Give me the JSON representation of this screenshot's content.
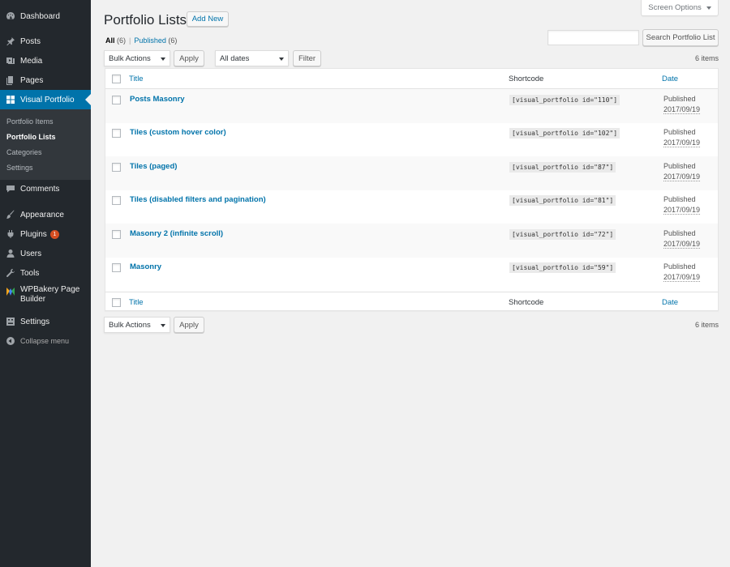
{
  "sidebar": {
    "menu": [
      {
        "label": "Dashboard",
        "icon": "dashboard-icon"
      },
      {
        "label": "Posts",
        "icon": "pin-icon"
      },
      {
        "label": "Media",
        "icon": "media-icon"
      },
      {
        "label": "Pages",
        "icon": "pages-icon"
      },
      {
        "label": "Visual Portfolio",
        "icon": "grid-icon"
      },
      {
        "label": "Comments",
        "icon": "comment-icon"
      },
      {
        "label": "Appearance",
        "icon": "brush-icon"
      },
      {
        "label": "Plugins",
        "icon": "plug-icon",
        "badge": "1"
      },
      {
        "label": "Users",
        "icon": "user-icon"
      },
      {
        "label": "Tools",
        "icon": "wrench-icon"
      },
      {
        "label_line1": "WPBakery Page",
        "label_line2": "Builder",
        "icon": "wpbakery-icon"
      },
      {
        "label": "Settings",
        "icon": "settings-icon"
      },
      {
        "label": "Collapse menu",
        "icon": "collapse-icon"
      }
    ],
    "submenu": [
      {
        "label": "Portfolio Items"
      },
      {
        "label": "Portfolio Lists"
      },
      {
        "label": "Categories"
      },
      {
        "label": "Settings"
      }
    ]
  },
  "header": {
    "title": "Portfolio Lists",
    "add_new": "Add New",
    "screen_options": "Screen Options"
  },
  "filters": {
    "all": "All",
    "all_count": "(6)",
    "sep": "|",
    "published": "Published",
    "published_count": "(6)"
  },
  "search": {
    "value": "",
    "button": "Search Portfolio List"
  },
  "tablenav": {
    "bulk_actions": "Bulk Actions",
    "apply": "Apply",
    "dates": "All dates",
    "filter": "Filter",
    "items_count": "6 items"
  },
  "table": {
    "columns": {
      "title": "Title",
      "shortcode": "Shortcode",
      "date": "Date"
    },
    "rows": [
      {
        "title": "Posts Masonry",
        "shortcode": "[visual_portfolio id=\"110\"]",
        "status": "Published",
        "date": "2017/09/19"
      },
      {
        "title": "Tiles (custom hover color)",
        "shortcode": "[visual_portfolio id=\"102\"]",
        "status": "Published",
        "date": "2017/09/19"
      },
      {
        "title": "Tiles (paged)",
        "shortcode": "[visual_portfolio id=\"87\"]",
        "status": "Published",
        "date": "2017/09/19"
      },
      {
        "title": "Tiles (disabled filters and pagination)",
        "shortcode": "[visual_portfolio id=\"81\"]",
        "status": "Published",
        "date": "2017/09/19"
      },
      {
        "title": "Masonry 2 (infinite scroll)",
        "shortcode": "[visual_portfolio id=\"72\"]",
        "status": "Published",
        "date": "2017/09/19"
      },
      {
        "title": "Masonry",
        "shortcode": "[visual_portfolio id=\"59\"]",
        "status": "Published",
        "date": "2017/09/19"
      }
    ]
  },
  "colors": {
    "sidebar_bg": "#23282d",
    "accent": "#0073aa",
    "badge": "#d54e21"
  }
}
